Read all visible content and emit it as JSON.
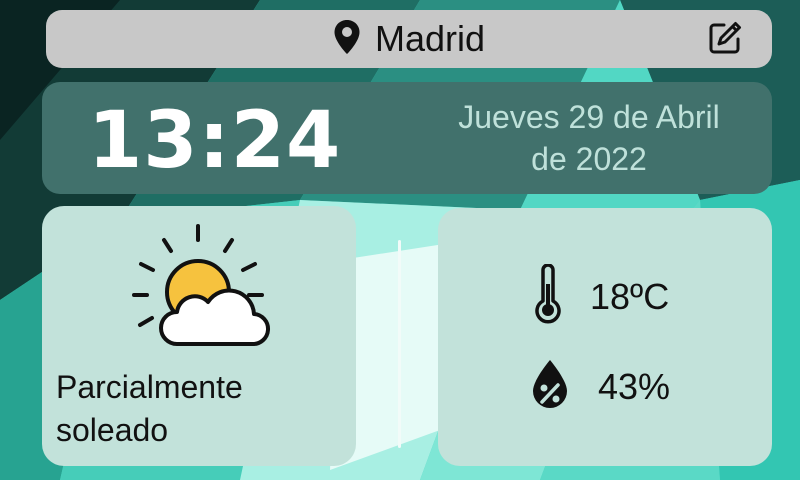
{
  "location": {
    "city": "Madrid",
    "pin_icon": "map-pin-icon",
    "edit_icon": "edit-icon"
  },
  "clock": {
    "time": "13:24"
  },
  "date": {
    "line1": "Jueves 29 de Abril",
    "line2": "de 2022"
  },
  "weather": {
    "condition_line1": "Parcialmente",
    "condition_line2": "soleado",
    "icon": "partly-sunny-icon"
  },
  "stats": {
    "temperature": "18ºC",
    "humidity": "43%",
    "temperature_icon": "thermometer-icon",
    "humidity_icon": "humidity-drop-icon"
  },
  "colors": {
    "location_bar": "#c8c8c8",
    "time_panel": "#41716c",
    "date_text": "#bfe1da",
    "card": "#c2e2da",
    "sun": "#f6c23e",
    "background": "#3fd3bf"
  }
}
